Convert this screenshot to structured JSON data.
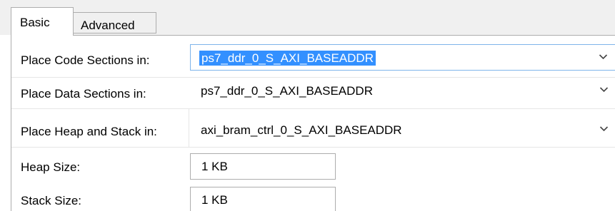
{
  "tabs": [
    {
      "label": "Basic",
      "active": true
    },
    {
      "label": "Advanced",
      "active": false
    }
  ],
  "fields": {
    "code_sections": {
      "label": "Place Code Sections in:",
      "value": "ps7_ddr_0_S_AXI_BASEADDR"
    },
    "data_sections": {
      "label": "Place Data Sections in:",
      "value": "ps7_ddr_0_S_AXI_BASEADDR"
    },
    "heap_stack": {
      "label": "Place Heap and Stack in:",
      "value": "axi_bram_ctrl_0_S_AXI_BASEADDR"
    },
    "heap_size": {
      "label": "Heap Size:",
      "value": "1 KB"
    },
    "stack_size": {
      "label": "Stack Size:",
      "value": "1 KB"
    }
  },
  "colors": {
    "selection": "#3390ff",
    "focus_border": "#7eb4ea",
    "border": "#adadad",
    "tab_strip": "#f0f0f0"
  },
  "icons": {
    "dropdown": "chevron-down-icon"
  }
}
